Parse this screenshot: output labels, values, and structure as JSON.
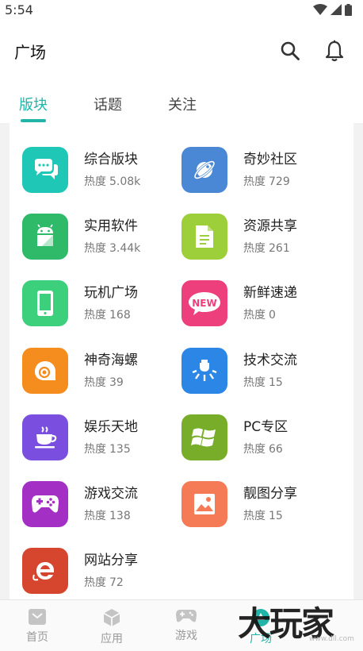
{
  "status": {
    "time": "5:54"
  },
  "header": {
    "title": "广场"
  },
  "tabs": [
    {
      "label": "版块",
      "active": true
    },
    {
      "label": "话题",
      "active": false
    },
    {
      "label": "关注",
      "active": false
    }
  ],
  "heat_prefix": "热度",
  "boards": [
    {
      "name": "综合版块",
      "heat": "5.08k",
      "color": "#1fc7b6",
      "icon": "chat-bubbles-icon"
    },
    {
      "name": "奇妙社区",
      "heat": "729",
      "color": "#4a87d4",
      "icon": "planet-icon"
    },
    {
      "name": "实用软件",
      "heat": "3.44k",
      "color": "#2fba6a",
      "icon": "android-icon"
    },
    {
      "name": "资源共享",
      "heat": "261",
      "color": "#9ccf3a",
      "icon": "document-icon"
    },
    {
      "name": "玩机广场",
      "heat": "168",
      "color": "#3ccf7c",
      "icon": "phone-icon"
    },
    {
      "name": "新鲜速递",
      "heat": "0",
      "color": "#ec3f7c",
      "icon": "new-badge-icon"
    },
    {
      "name": "神奇海螺",
      "heat": "39",
      "color": "#f58c1e",
      "icon": "shell-icon"
    },
    {
      "name": "技术交流",
      "heat": "15",
      "color": "#2b86e6",
      "icon": "lamp-icon"
    },
    {
      "name": "娱乐天地",
      "heat": "135",
      "color": "#7a4fe0",
      "icon": "coffee-icon"
    },
    {
      "name": "PC专区",
      "heat": "66",
      "color": "#78ad2a",
      "icon": "windows-icon"
    },
    {
      "name": "游戏交流",
      "heat": "138",
      "color": "#a42fc5",
      "icon": "gamepad-icon"
    },
    {
      "name": "靓图分享",
      "heat": "15",
      "color": "#f57b57",
      "icon": "image-icon"
    },
    {
      "name": "网站分享",
      "heat": "72",
      "color": "#d6452d",
      "icon": "browser-e-icon"
    }
  ],
  "nav": [
    {
      "label": "首页",
      "icon": "home-box-icon",
      "active": false
    },
    {
      "label": "应用",
      "icon": "cube-icon",
      "active": false
    },
    {
      "label": "游戏",
      "icon": "gamepad-icon",
      "active": false
    },
    {
      "label": "广场",
      "icon": "plaza-icon",
      "active": true
    }
  ],
  "watermark": {
    "text": "大玩家",
    "sub": "www.dll.com"
  },
  "colors": {
    "accent": "#20b5a8"
  }
}
